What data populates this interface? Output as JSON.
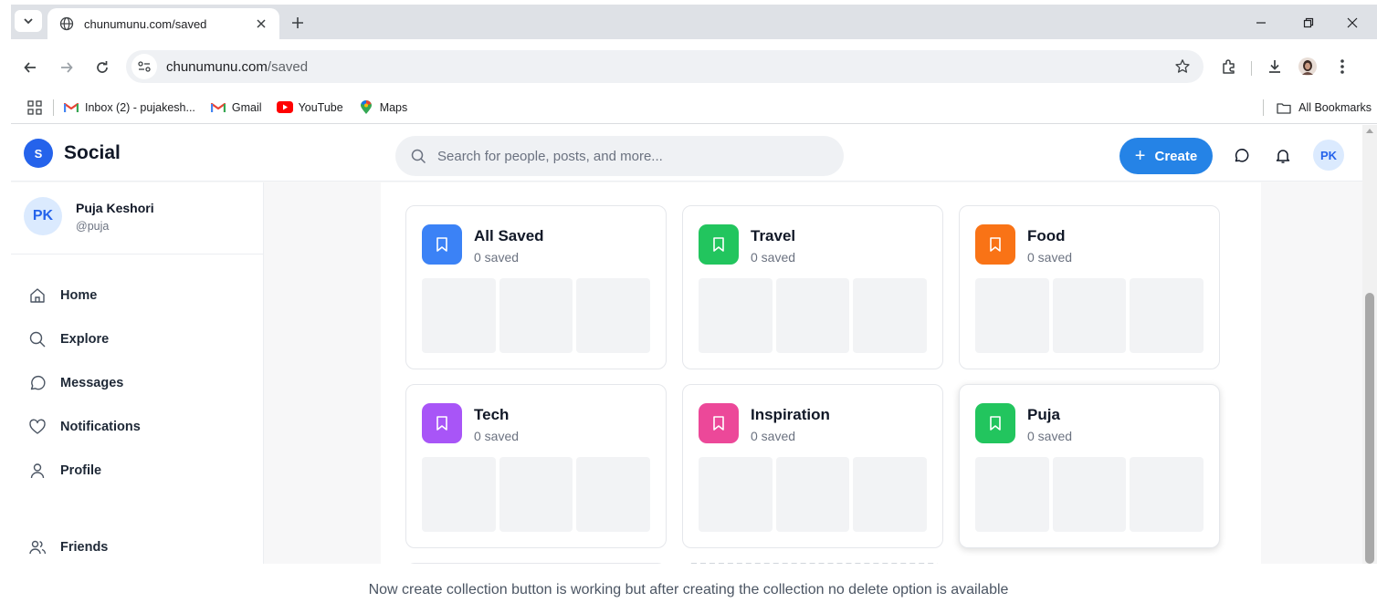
{
  "browser": {
    "tab": {
      "title": "chunumunu.com/saved"
    },
    "address": {
      "host": "chunumunu.com",
      "path": "/saved"
    },
    "bookmarks": [
      {
        "label": "Inbox (2) - pujakesh...",
        "icon": "gmail-icon"
      },
      {
        "label": "Gmail",
        "icon": "gmail-icon"
      },
      {
        "label": "YouTube",
        "icon": "youtube-icon"
      },
      {
        "label": "Maps",
        "icon": "maps-icon"
      }
    ],
    "all_bookmarks": "All Bookmarks"
  },
  "app": {
    "logo_letter": "S",
    "logo_text": "Social",
    "search_placeholder": "Search for people, posts, and more...",
    "create_label": "Create",
    "create_plus": "+",
    "avatar_initials": "PK"
  },
  "profile": {
    "initials": "PK",
    "name": "Puja Keshori",
    "handle": "@puja"
  },
  "nav": [
    {
      "label": "Home",
      "icon": "home-icon"
    },
    {
      "label": "Explore",
      "icon": "search-icon"
    },
    {
      "label": "Messages",
      "icon": "message-icon"
    },
    {
      "label": "Notifications",
      "icon": "heart-icon"
    },
    {
      "label": "Profile",
      "icon": "user-icon"
    },
    {
      "label": "Friends",
      "icon": "users-icon"
    }
  ],
  "collections": [
    {
      "name": "All Saved",
      "count": "0 saved",
      "color": "#3b82f6"
    },
    {
      "name": "Travel",
      "count": "0 saved",
      "color": "#22c55e"
    },
    {
      "name": "Food",
      "count": "0 saved",
      "color": "#f97316"
    },
    {
      "name": "Tech",
      "count": "0 saved",
      "color": "#a855f7"
    },
    {
      "name": "Inspiration",
      "count": "0 saved",
      "color": "#ec4899"
    },
    {
      "name": "Puja",
      "count": "0 saved",
      "color": "#22c55e"
    }
  ],
  "caption": "Now create collection button is working but after creating the collection no delete option is available"
}
